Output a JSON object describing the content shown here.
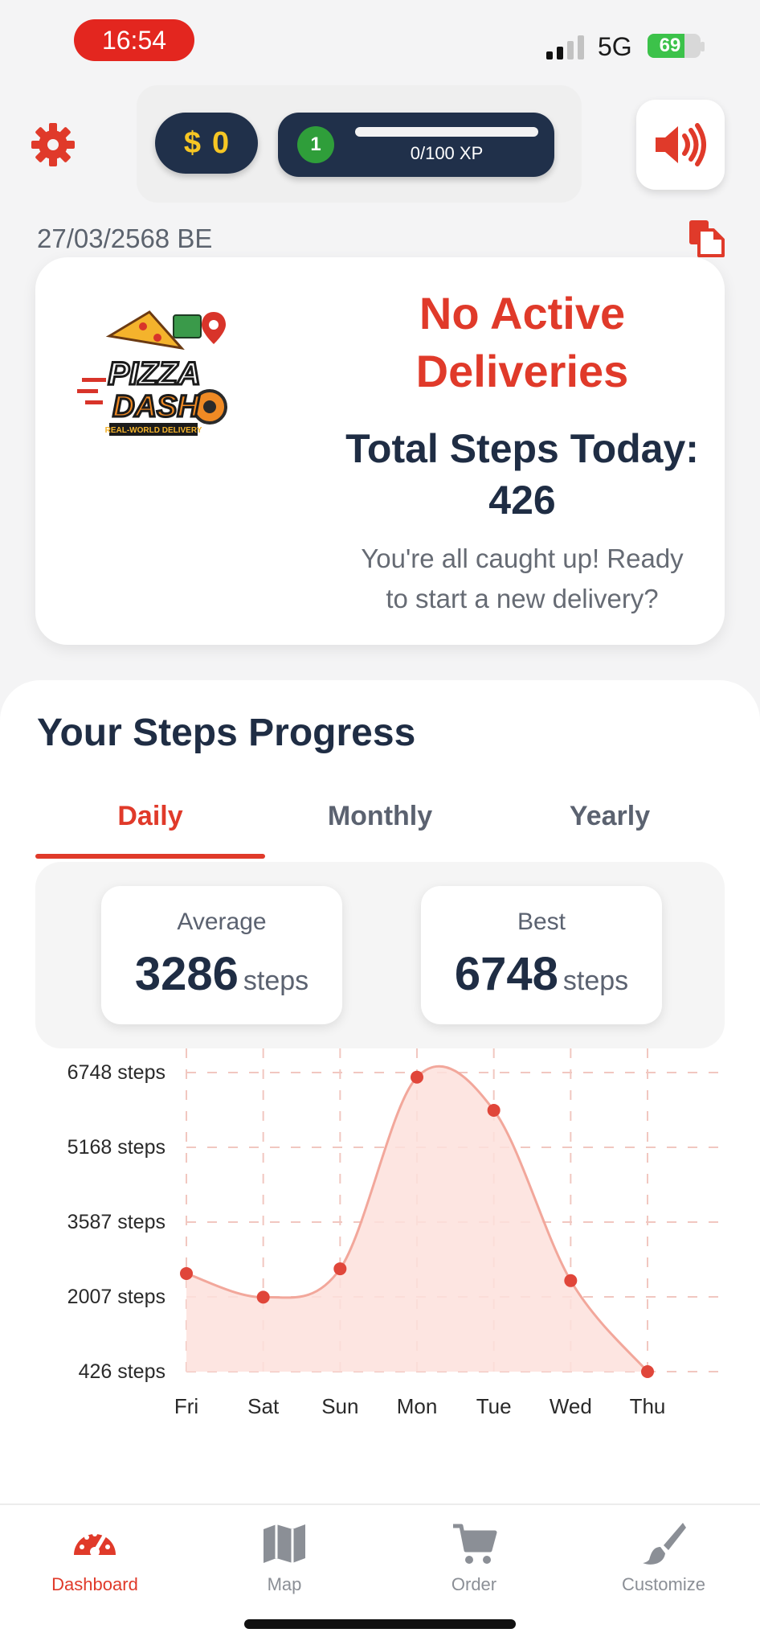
{
  "status_bar": {
    "time": "16:54",
    "network": "5G",
    "battery": "69",
    "battery_level": 0.69
  },
  "header": {
    "coins_symbol": "$",
    "coins_value": "0",
    "level": "1",
    "xp_text": "0/100 XP",
    "xp_progress": 0
  },
  "date": "27/03/2568 BE",
  "delivery_card": {
    "logo_line1": "PIZZA",
    "logo_line2": "DASH",
    "logo_tagline": "REAL-WORLD DELIVERY",
    "title_line1": "No Active",
    "title_line2": "Deliveries",
    "steps_label": "Total Steps Today:",
    "steps_value": "426",
    "message_line1": "You're all caught up! Ready",
    "message_line2": "to start a new delivery?"
  },
  "progress": {
    "title": "Your Steps Progress",
    "tabs": [
      {
        "label": "Daily",
        "active": true
      },
      {
        "label": "Monthly",
        "active": false
      },
      {
        "label": "Yearly",
        "active": false
      }
    ],
    "stats": {
      "average_label": "Average",
      "average_value": "3286",
      "best_label": "Best",
      "best_value": "6748",
      "unit": "steps"
    }
  },
  "chart_data": {
    "type": "area",
    "title": "",
    "xlabel": "",
    "ylabel": "",
    "x": [
      "Fri",
      "Sat",
      "Sun",
      "Mon",
      "Tue",
      "Wed",
      "Thu"
    ],
    "series": [
      {
        "values": [
          2500,
          2000,
          2600,
          6650,
          5950,
          2350,
          426
        ]
      }
    ],
    "y_ticks": [
      {
        "value": 6748,
        "label": "6748 steps"
      },
      {
        "value": 5168,
        "label": "5168 steps"
      },
      {
        "value": 3587,
        "label": "3587 steps"
      },
      {
        "value": 2007,
        "label": "2007 steps"
      },
      {
        "value": 426,
        "label": "426 steps"
      }
    ],
    "ylim": [
      426,
      6748
    ],
    "grid": true,
    "legend": "none",
    "colors": {
      "line": "#f2a79b",
      "fill": "#fde0dc",
      "point": "#e0463a",
      "grid": "#f1c7c0"
    }
  },
  "nav": [
    {
      "label": "Dashboard",
      "icon": "dashboard-gauge-icon",
      "active": true
    },
    {
      "label": "Map",
      "icon": "map-icon",
      "active": false
    },
    {
      "label": "Order",
      "icon": "cart-icon",
      "active": false
    },
    {
      "label": "Customize",
      "icon": "brush-icon",
      "active": false
    }
  ],
  "colors": {
    "accent": "#e03a2a",
    "navy": "#20304a",
    "gold": "#f6c624",
    "green": "#2f9e3a"
  }
}
